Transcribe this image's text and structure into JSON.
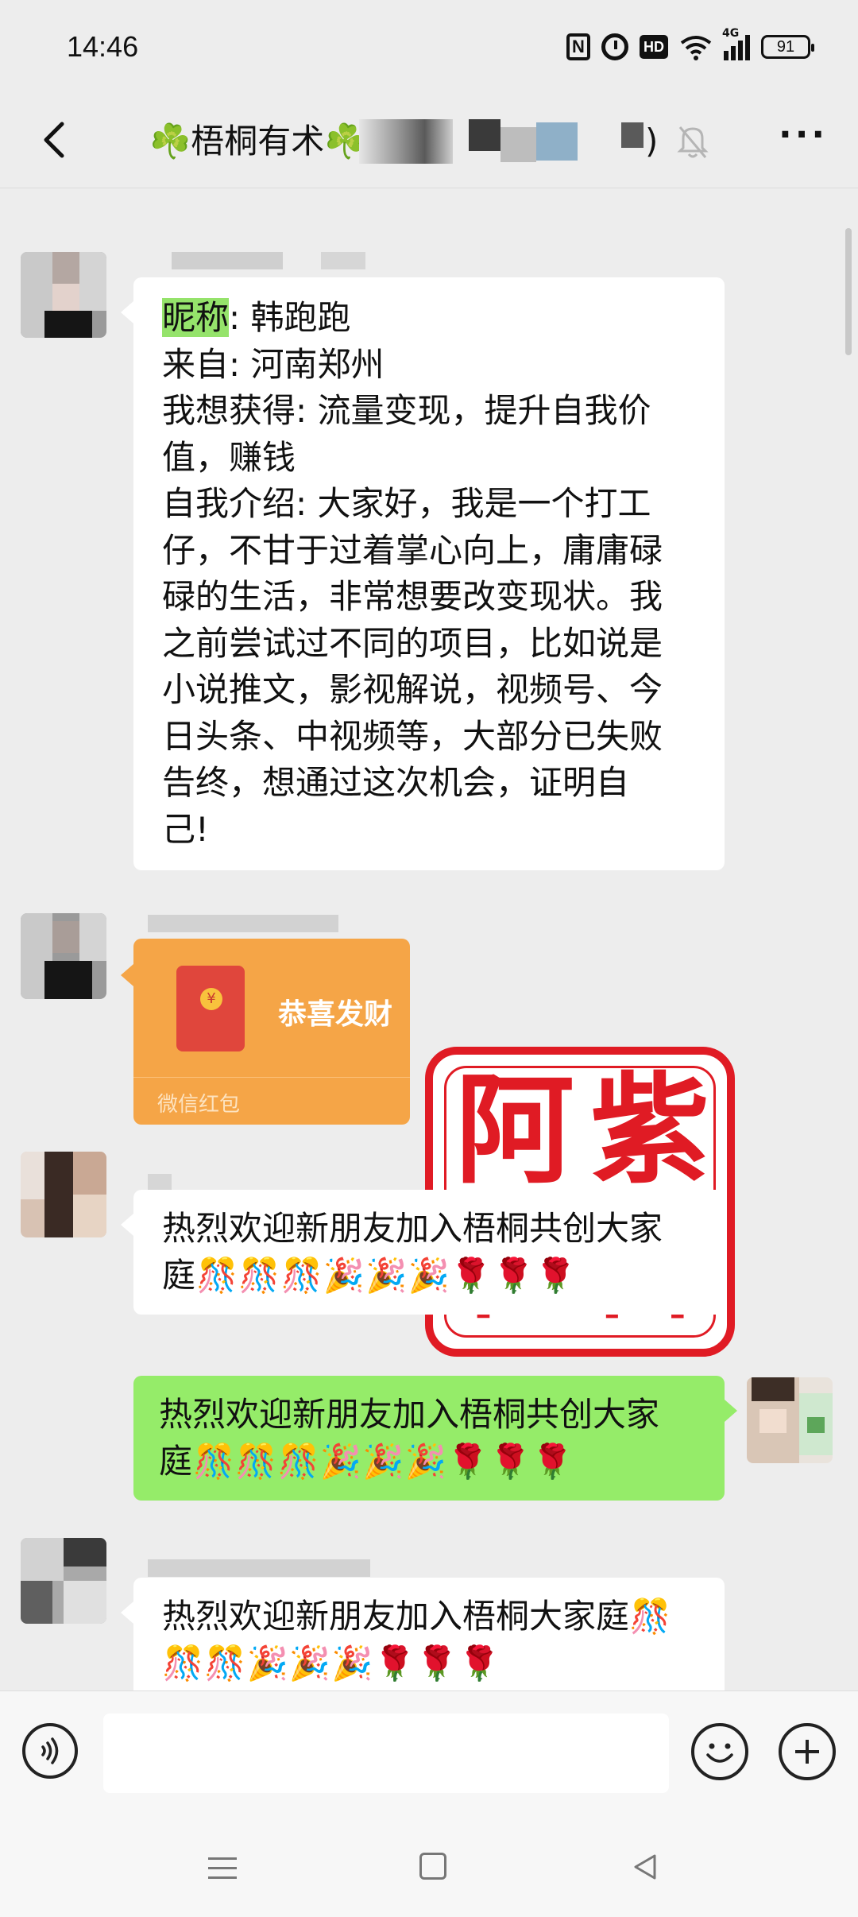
{
  "status_bar": {
    "time": "14:46",
    "nfc_label": "N",
    "hd_label": "HD",
    "network_label": "4G",
    "battery": "91"
  },
  "header": {
    "title": "☘️梧桐有术☘️",
    "title_suffix": ")"
  },
  "messages": [
    {
      "side": "left",
      "type": "text",
      "highlight": "昵称",
      "lines": [
        ": 韩跑跑",
        "来自: 河南郑州",
        "我想获得: 流量变现，提升自我价",
        "值，赚钱",
        "自我介绍: 大家好，我是一个打工",
        "仔，不甘于过着掌心向上，庸庸碌",
        "碌的生活，非常想要改变现状。我",
        "之前尝试过不同的项目，比如说是",
        "小说推文，影视解说，视频号、今",
        "日头条、中视频等，大部分已失败",
        "告终，想通过这次机会，证明自",
        "己!"
      ]
    },
    {
      "side": "left",
      "type": "red_packet",
      "title": "恭喜发财",
      "label": "微信红包",
      "coin": "¥"
    },
    {
      "side": "left",
      "type": "text",
      "lines": [
        "热烈欢迎新朋友加入梧桐共创大家",
        "庭🎊🎊🎊🎉🎉🎉🌹🌹🌹"
      ]
    },
    {
      "side": "right",
      "type": "text",
      "lines": [
        "热烈欢迎新朋友加入梧桐共创大家",
        "庭🎊🎊🎊🎉🎉🎉🌹🌹🌹"
      ]
    },
    {
      "side": "left",
      "type": "text",
      "lines": [
        "热烈欢迎新朋友加入梧桐大家庭🎊",
        "🎊🎊🎉🎉🎉🌹🌹🌹"
      ]
    }
  ],
  "stamp": {
    "chars": [
      "阿",
      "紫",
      "社",
      "群"
    ],
    "color": "#e01b24"
  },
  "colors": {
    "background": "#ededed",
    "my_bubble": "#95ec69",
    "red_packet": "#f5a547"
  },
  "icons": {
    "back": "chevron-left-icon",
    "mute": "bell-off-icon",
    "more": "more-dots-icon",
    "voice": "voice-icon",
    "emoji": "emoji-icon",
    "plus": "plus-icon"
  }
}
